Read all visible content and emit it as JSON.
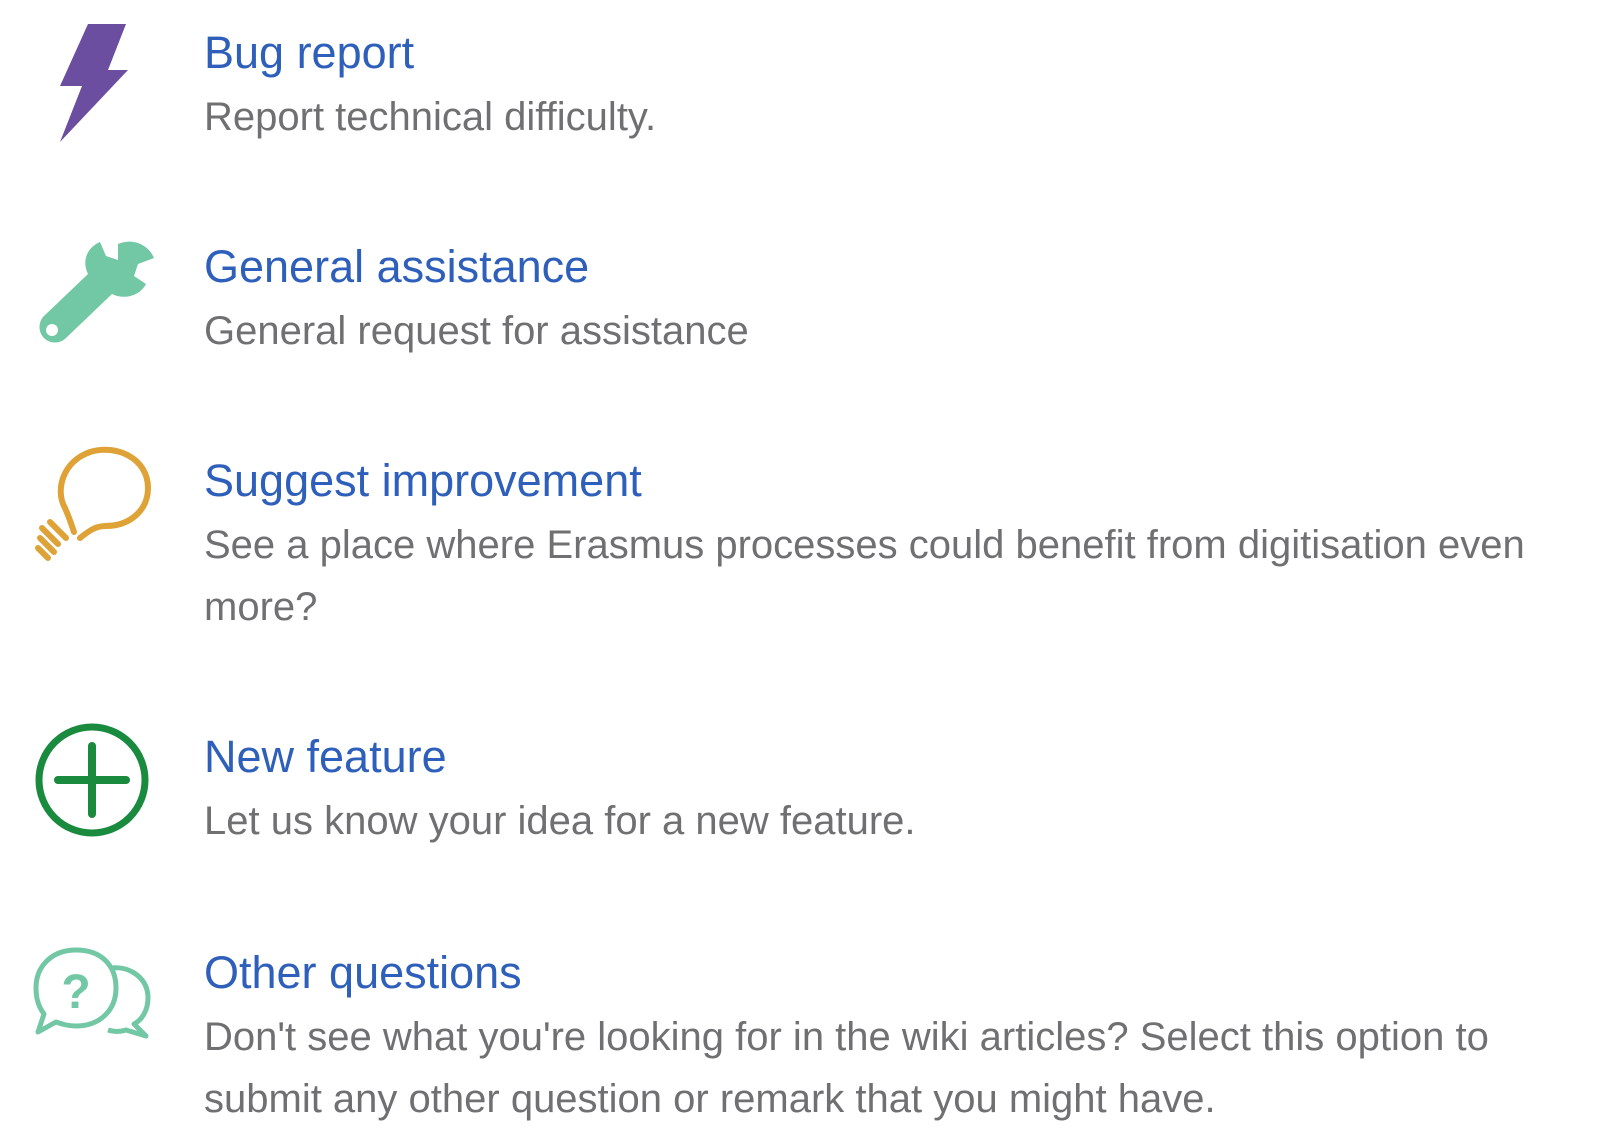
{
  "colors": {
    "title": "#2e5fba",
    "description": "#707072",
    "bug_icon": "#6b4ea0",
    "general_icon": "#72c7a4",
    "suggest_icon": "#dea237",
    "feature_icon": "#1a8a3f",
    "other_icon": "#72c7a4"
  },
  "request_types": [
    {
      "icon": "lightning-bolt-icon",
      "title": "Bug report",
      "description": "Report technical difficulty."
    },
    {
      "icon": "wrench-icon",
      "title": "General assistance",
      "description": "General request for assistance"
    },
    {
      "icon": "lightbulb-icon",
      "title": "Suggest improvement",
      "description": "See a place where Erasmus processes could benefit from digitisation even more?"
    },
    {
      "icon": "plus-circle-icon",
      "title": "New feature",
      "description": "Let us know your idea for a new feature."
    },
    {
      "icon": "question-chat-bubbles-icon",
      "title": "Other questions",
      "description": "Don't see what you're looking for in the wiki articles? Select this option to submit any other question or remark that you might have."
    }
  ]
}
